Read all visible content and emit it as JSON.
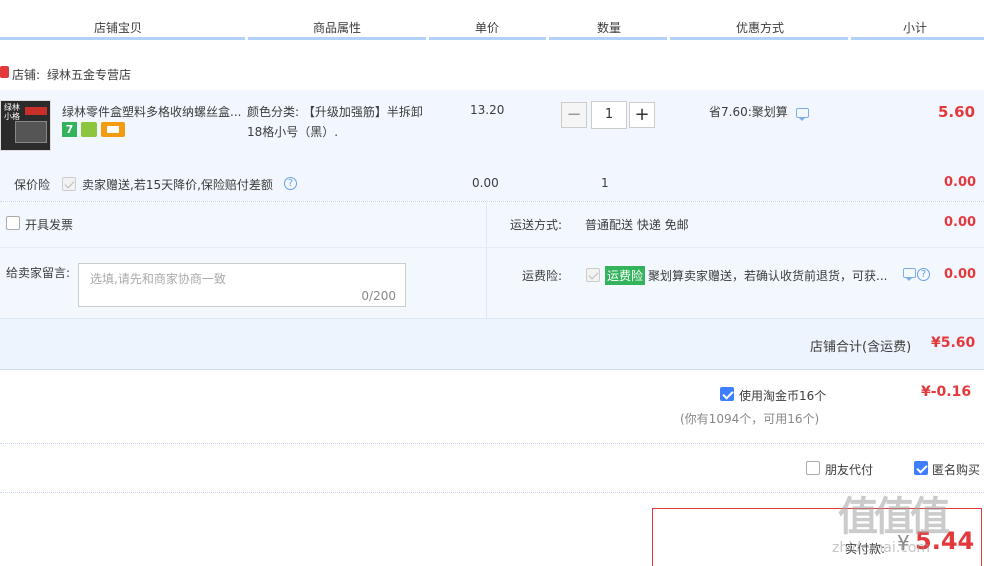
{
  "header": {
    "col_shop_item": "店铺宝贝",
    "col_attributes": "商品属性",
    "col_unit_price": "单价",
    "col_quantity": "数量",
    "col_discount": "优惠方式",
    "col_subtotal": "小计"
  },
  "shop": {
    "label": "店铺:",
    "name": "绿林五金专营店"
  },
  "item": {
    "title": "绿林零件盒塑料多格收纳螺丝盒...",
    "attr_line1": "颜色分类: 【升级加强筋】半拆卸",
    "attr_line2": "18格小号（黑）.",
    "unit_price": "13.20",
    "quantity": "1",
    "qty_minus": "−",
    "qty_plus": "+",
    "discount": "省7.60:聚划算",
    "subtotal": "5.60",
    "badge_seven": "7",
    "thumb_text": "绿林\n小格"
  },
  "insurance": {
    "label": "保价险",
    "desc": "卖家赠送,若15天降价,保险赔付差额",
    "price": "0.00",
    "qty": "1",
    "subtotal": "0.00"
  },
  "invoice": {
    "label": "开具发票"
  },
  "shipping": {
    "label": "运送方式:",
    "value": "普通配送 快递 免邮",
    "price": "0.00"
  },
  "message": {
    "label": "给卖家留言:",
    "placeholder": "选填,请先和商家协商一致",
    "counter": "0/200"
  },
  "freight_insurance": {
    "label": "运费险:",
    "tag": "运费险",
    "desc": "聚划算卖家赠送，若确认收货前退货，可获...",
    "price": "0.00"
  },
  "shop_total": {
    "label": "店铺合计(含运费)",
    "value": "¥5.60"
  },
  "coins": {
    "label": "使用淘金币16个",
    "sub": "(你有1094个，可用16个)",
    "value": "¥-0.16"
  },
  "options": {
    "friend_pay": "朋友代付",
    "anonymous": "匿名购买"
  },
  "payment": {
    "label": "实付款:",
    "currency": "¥",
    "value": "5.44"
  },
  "watermark": {
    "glyphs": "值值值",
    "site": "zhidemai.com"
  },
  "colors": {
    "accent_blue": "#3d7fff",
    "price_red": "#e4393c",
    "band_bg": "#f2f7ff",
    "header_line": "#b2d1ff"
  }
}
